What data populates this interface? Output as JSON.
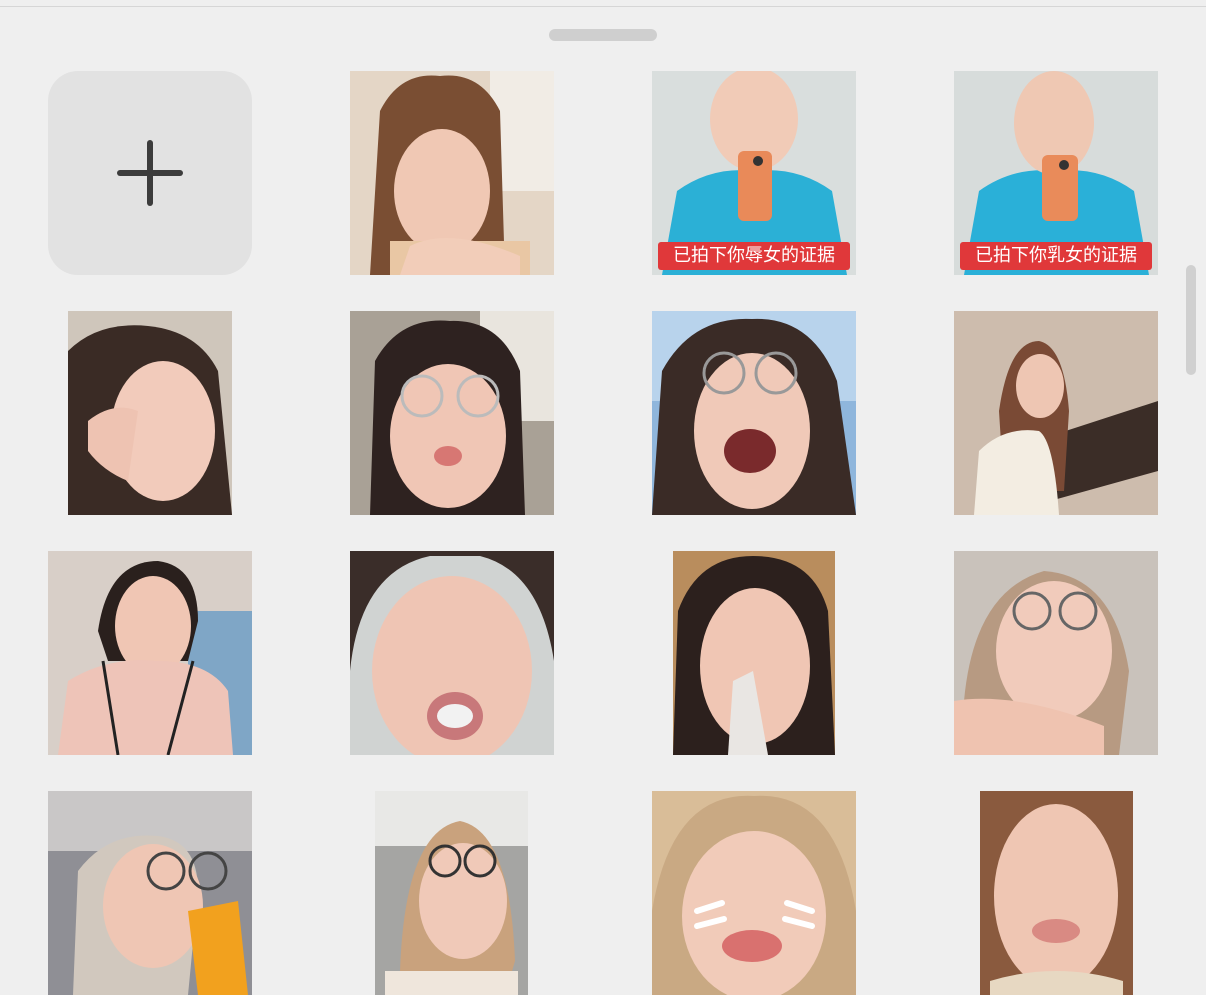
{
  "panel": {
    "title": "",
    "add_button_label": ""
  },
  "stickers": [
    {
      "id": 1,
      "caption": ""
    },
    {
      "id": 2,
      "caption": "已拍下你辱女的证据"
    },
    {
      "id": 3,
      "caption": "已拍下你乳女的证据"
    },
    {
      "id": 4,
      "caption": ""
    },
    {
      "id": 5,
      "caption": ""
    },
    {
      "id": 6,
      "caption": ""
    },
    {
      "id": 7,
      "caption": ""
    },
    {
      "id": 8,
      "caption": ""
    },
    {
      "id": 9,
      "caption": ""
    },
    {
      "id": 10,
      "caption": ""
    },
    {
      "id": 11,
      "caption": ""
    },
    {
      "id": 12,
      "caption": ""
    },
    {
      "id": 13,
      "caption": ""
    },
    {
      "id": 14,
      "caption": ""
    },
    {
      "id": 15,
      "caption": ""
    }
  ],
  "colors": {
    "background": "#efefef",
    "tile": "#e2e2e2",
    "plus": "#3c3c3c",
    "caption_bg": "#e0383a",
    "caption_text": "#ffffff"
  }
}
